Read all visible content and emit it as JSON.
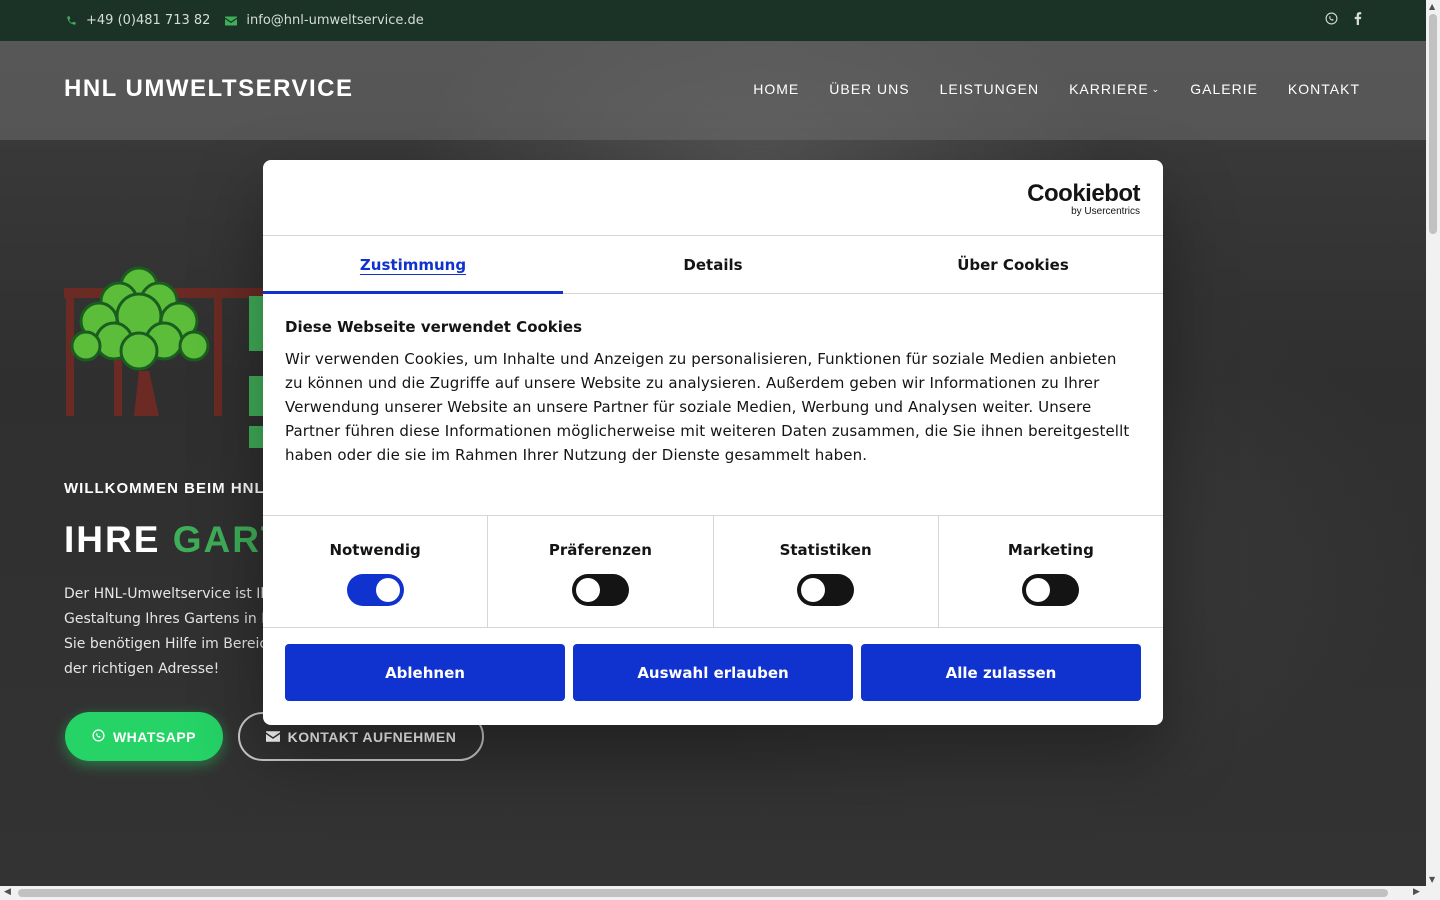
{
  "topbar": {
    "phone": "+49 (0)481 713 82",
    "email": "info@hnl-umweltservice.de",
    "social": [
      "whatsapp-icon",
      "facebook-icon"
    ]
  },
  "nav": {
    "brand": "HNL UMWELTSERVICE",
    "items": [
      "HOME",
      "ÜBER UNS",
      "LEISTUNGEN",
      "KARRIERE",
      "GALERIE",
      "KONTAKT"
    ]
  },
  "hero": {
    "welcome": "WILLKOMMEN BEIM HNL-",
    "headline_white": "IHRE ",
    "headline_green": "GART",
    "intro_lines": [
      "Der HNL-Umweltservice ist Ih",
      "Gestaltung Ihres Gartens in D",
      "Sie benötigen Hilfe im Bereic",
      "der richtigen Adresse!"
    ],
    "whatsapp_label": "WHATSAPP",
    "contact_label": "KONTAKT AUFNEHMEN"
  },
  "cookie": {
    "brand": "Cookiebot",
    "brand_sub": "by Usercentrics",
    "tabs": [
      "Zustimmung",
      "Details",
      "Über Cookies"
    ],
    "title": "Diese Webseite verwendet Cookies",
    "text": "Wir verwenden Cookies, um Inhalte und Anzeigen zu personalisieren, Funktionen für soziale Medien anbieten zu können und die Zugriffe auf unsere Website zu analysieren. Außerdem geben wir Informationen zu Ihrer Verwendung unserer Website an unsere Partner für soziale Medien, Werbung und Analysen weiter. Unsere Partner führen diese Informationen möglicherweise mit weiteren Daten zusammen, die Sie ihnen bereitgestellt haben oder die sie im Rahmen Ihrer Nutzung der Dienste gesammelt haben.",
    "categories": [
      {
        "label": "Notwendig",
        "on": true
      },
      {
        "label": "Präferenzen",
        "on": false
      },
      {
        "label": "Statistiken",
        "on": false
      },
      {
        "label": "Marketing",
        "on": false
      }
    ],
    "buttons": [
      "Ablehnen",
      "Auswahl erlauben",
      "Alle zulassen"
    ]
  },
  "colors": {
    "accent_green": "#3fae58",
    "cookiebot_blue": "#1032cf",
    "whatsapp_green": "#25d366",
    "topbar_bg": "#1b3326"
  }
}
